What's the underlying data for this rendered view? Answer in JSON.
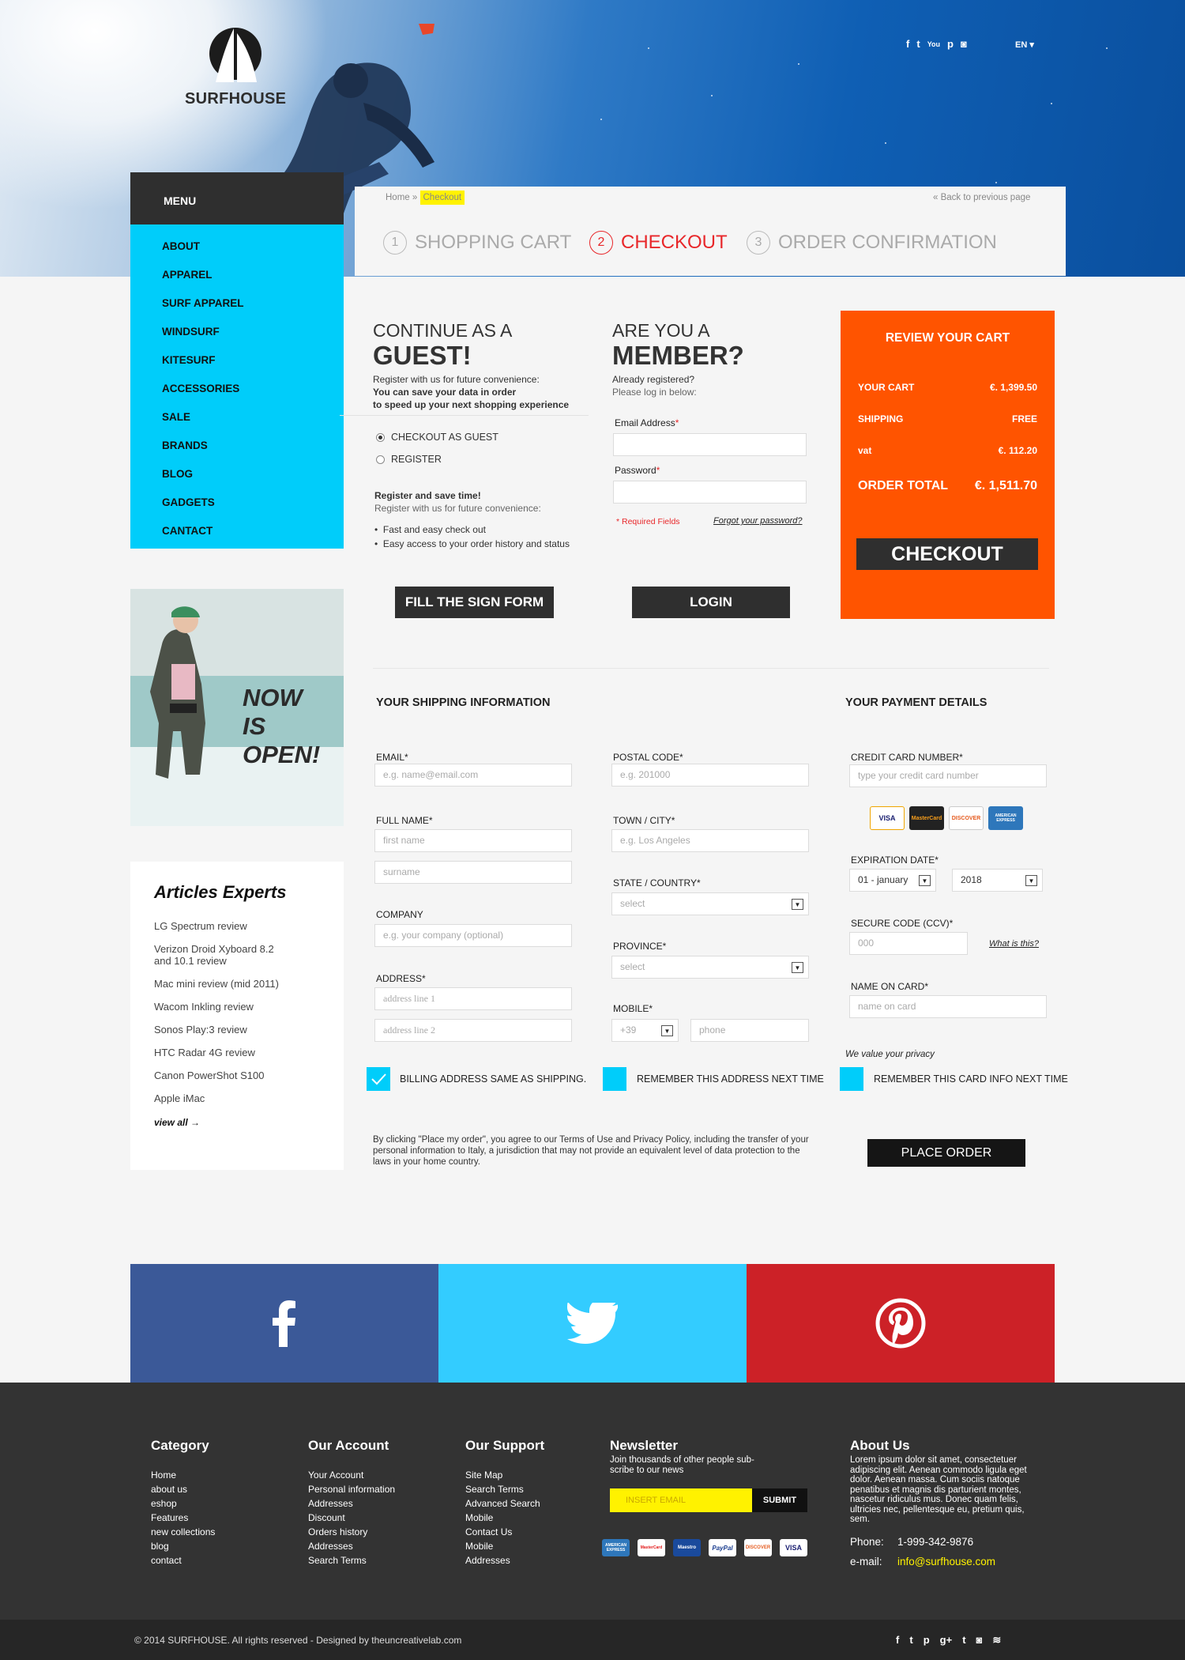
{
  "header": {
    "brand": "SURFHOUSE",
    "social_icons": [
      "facebook-icon",
      "twitter-icon",
      "youtube-icon",
      "pinterest-icon",
      "instagram-icon"
    ],
    "social_glyphs": [
      "f",
      "t",
      "You",
      "p",
      "◙"
    ],
    "language": "EN ▾"
  },
  "menu": {
    "title": "MENU",
    "items": [
      "ABOUT",
      "APPAREL",
      "SURF APPAREL",
      "WINDSURF",
      "KITESURF",
      "ACCESSORIES",
      "SALE",
      "BRANDS",
      "BLOG",
      "GADGETS",
      "CANTACT"
    ]
  },
  "breadcrumb": {
    "home": "Home",
    "separator": "»",
    "current": "Checkout",
    "back": "« Back to previous page"
  },
  "steps": [
    {
      "num": "1",
      "label": "SHOPPING CART"
    },
    {
      "num": "2",
      "label": "CHECKOUT"
    },
    {
      "num": "3",
      "label": "ORDER CONFIRMATION"
    }
  ],
  "guest": {
    "title_small": "CONTINUE AS A",
    "title_big": "GUEST!",
    "desc1": "Register with us for future convenience:",
    "desc2": "You can save your data in order",
    "desc3": "to speed up your next shopping experience",
    "option1": "CHECKOUT AS GUEST",
    "option2": "REGISTER",
    "save_title": "Register and save time!",
    "save_sub": "Register with us for future convenience:",
    "bullet1": "Fast and easy check out",
    "bullet2": "Easy access to your order history and status",
    "button": "FILL THE SIGN FORM"
  },
  "member": {
    "title_small": "ARE YOU A",
    "title_big": "MEMBER?",
    "desc1": "Already registered?",
    "desc2": "Please log in below:",
    "email_label": "Email Address",
    "password_label": "Password",
    "required": "* Required Fields",
    "forgot": "Forgot your password?",
    "button": "LOGIN"
  },
  "review": {
    "title": "REVIEW YOUR CART",
    "cart_label": "YOUR CART",
    "cart_value": "€. 1,399.50",
    "shipping_label": "SHIPPING",
    "shipping_value": "FREE",
    "vat_label": "vat",
    "vat_value": "€. 112.20",
    "total_label": "ORDER TOTAL",
    "total_value": "€. 1,511.70",
    "button": "CHECKOUT"
  },
  "promo": {
    "line1": "NOW",
    "line2": "IS",
    "line3": "OPEN!"
  },
  "articles": {
    "title": "Articles Experts",
    "items": [
      "LG Spectrum review",
      "Verizon Droid Xyboard 8.2 and 10.1 review",
      "Mac mini review (mid 2011)",
      "Wacom Inkling review",
      "Sonos Play:3 review",
      "HTC Radar 4G review",
      "Canon PowerShot S100",
      "Apple iMac"
    ],
    "view_all": "view all →"
  },
  "shipping": {
    "title": "YOUR SHIPPING INFORMATION",
    "email_label": "EMAIL*",
    "email_ph": "e.g. name@email.com",
    "fullname_label": "FULL NAME*",
    "first_ph": "first name",
    "surname_ph": "surname",
    "company_label": "COMPANY",
    "company_ph": "e.g. your company (optional)",
    "address_label": "ADDRESS*",
    "addr1_ph": "address line 1",
    "addr2_ph": "address line 2",
    "postal_label": "POSTAL CODE*",
    "postal_ph": "e.g. 201000",
    "town_label": "TOWN / CITY*",
    "town_ph": "e.g. Los Angeles",
    "state_label": "STATE / COUNTRY*",
    "state_ph": "select",
    "province_label": "PROVINCE*",
    "province_ph": "select",
    "mobile_label": "MOBILE*",
    "mobile_prefix": "+39",
    "phone_ph": "phone",
    "billing_same": "BILLING ADDRESS SAME AS SHIPPING.",
    "remember_address": "REMEMBER THIS ADDRESS NEXT TIME"
  },
  "payment": {
    "title": "YOUR PAYMENT DETAILS",
    "cc_label": "CREDIT CARD NUMBER*",
    "cc_ph": "type your credit card number",
    "cards": [
      "VISA",
      "MasterCard",
      "DISCOVER",
      "AMERICAN EXPRESS"
    ],
    "exp_label": "EXPIRATION DATE*",
    "exp_month": "01 - january",
    "exp_year": "2018",
    "ccv_label": "SECURE CODE (CCV)*",
    "ccv_ph": "000",
    "what": "What is this?",
    "name_label": "NAME ON CARD*",
    "name_ph": "name on card",
    "privacy": "We value your privacy",
    "remember_card": "REMEMBER THIS CARD INFO NEXT TIME",
    "button": "PLACE ORDER"
  },
  "legal": "By clicking \"Place my order\", you agree to our Terms of Use and Privacy Policy, including the transfer of your personal information to Italy, a jurisdiction that may not provide an equivalent level of data protection to the laws in your home country.",
  "social_blocks": [
    {
      "name": "facebook",
      "color": "#3b5998"
    },
    {
      "name": "twitter",
      "color": "#33ccff"
    },
    {
      "name": "pinterest",
      "color": "#cc2127"
    }
  ],
  "footer": {
    "category": {
      "title": "Category",
      "links": [
        "Home",
        "about us",
        "eshop",
        "Features",
        "new collections",
        "blog",
        "contact"
      ]
    },
    "account": {
      "title": "Our Account",
      "links": [
        "Your Account",
        "Personal information",
        "Addresses",
        "Discount",
        "Orders history",
        "Addresses",
        "Search Terms"
      ]
    },
    "support": {
      "title": "Our Support",
      "links": [
        "Site Map",
        "Search Terms",
        "Advanced Search",
        "Mobile",
        "Contact Us",
        "Mobile",
        "Addresses"
      ]
    },
    "newsletter": {
      "title": "Newsletter",
      "desc": "Join thousands of other people sub-scribe to our news",
      "placeholder": "INSERT EMAIL",
      "button": "SUBMIT",
      "cards": [
        "AMERICAN EXPRESS",
        "MasterCard",
        "Maestro",
        "PayPal",
        "DISCOVER",
        "VISA"
      ]
    },
    "about": {
      "title": "About Us",
      "text": "Lorem ipsum dolor sit amet, consectetuer adipiscing elit. Aenean commodo ligula eget dolor. Aenean massa. Cum sociis natoque penatibus et magnis dis parturient montes, nascetur ridiculus mus. Donec quam felis, ultricies nec, pellentesque eu, pretium quis, sem.",
      "phone_label": "Phone:",
      "phone": "1-999-342-9876",
      "email_label": "e-mail:",
      "email": "info@surfhouse.com"
    }
  },
  "bottom": {
    "copyright": "© 2014  SURFHOUSE. All rights reserved - Designed by theuncreativelab.com",
    "icons": [
      "facebook-icon",
      "twitter-icon",
      "pinterest-icon",
      "google-plus-icon",
      "tumblr-icon",
      "instagram-icon",
      "rss-icon"
    ],
    "glyphs": [
      "f",
      "t",
      "p",
      "g+",
      "t",
      "◙",
      "≋"
    ]
  },
  "colors": {
    "accent_blue": "#00cdfa",
    "orange": "#ff5400",
    "dark": "#2f2f2f",
    "red_step": "#e8272a",
    "yellow": "#fff200"
  }
}
